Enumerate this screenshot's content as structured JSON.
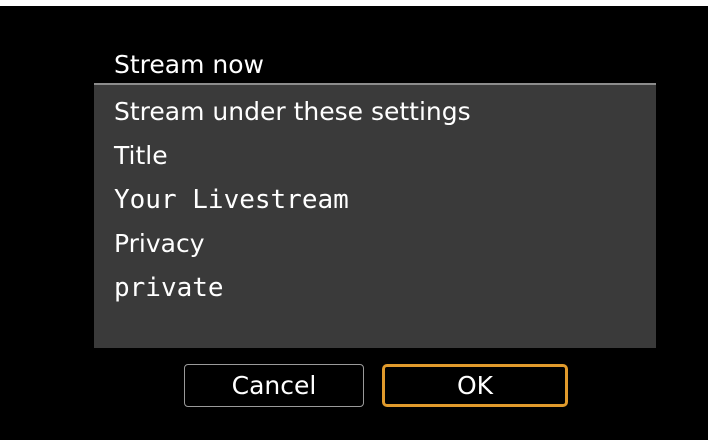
{
  "dialog": {
    "title": "Stream now",
    "lines": [
      "Stream under these settings",
      "Title",
      "Your Livestream",
      "Privacy",
      "private"
    ]
  },
  "buttons": {
    "cancel_label": "Cancel",
    "ok_label": "OK"
  },
  "colors": {
    "screen_background": "#000000",
    "panel_background": "#3a3a3a",
    "focus_accent": "#e09a2c",
    "text": "#ffffff"
  }
}
